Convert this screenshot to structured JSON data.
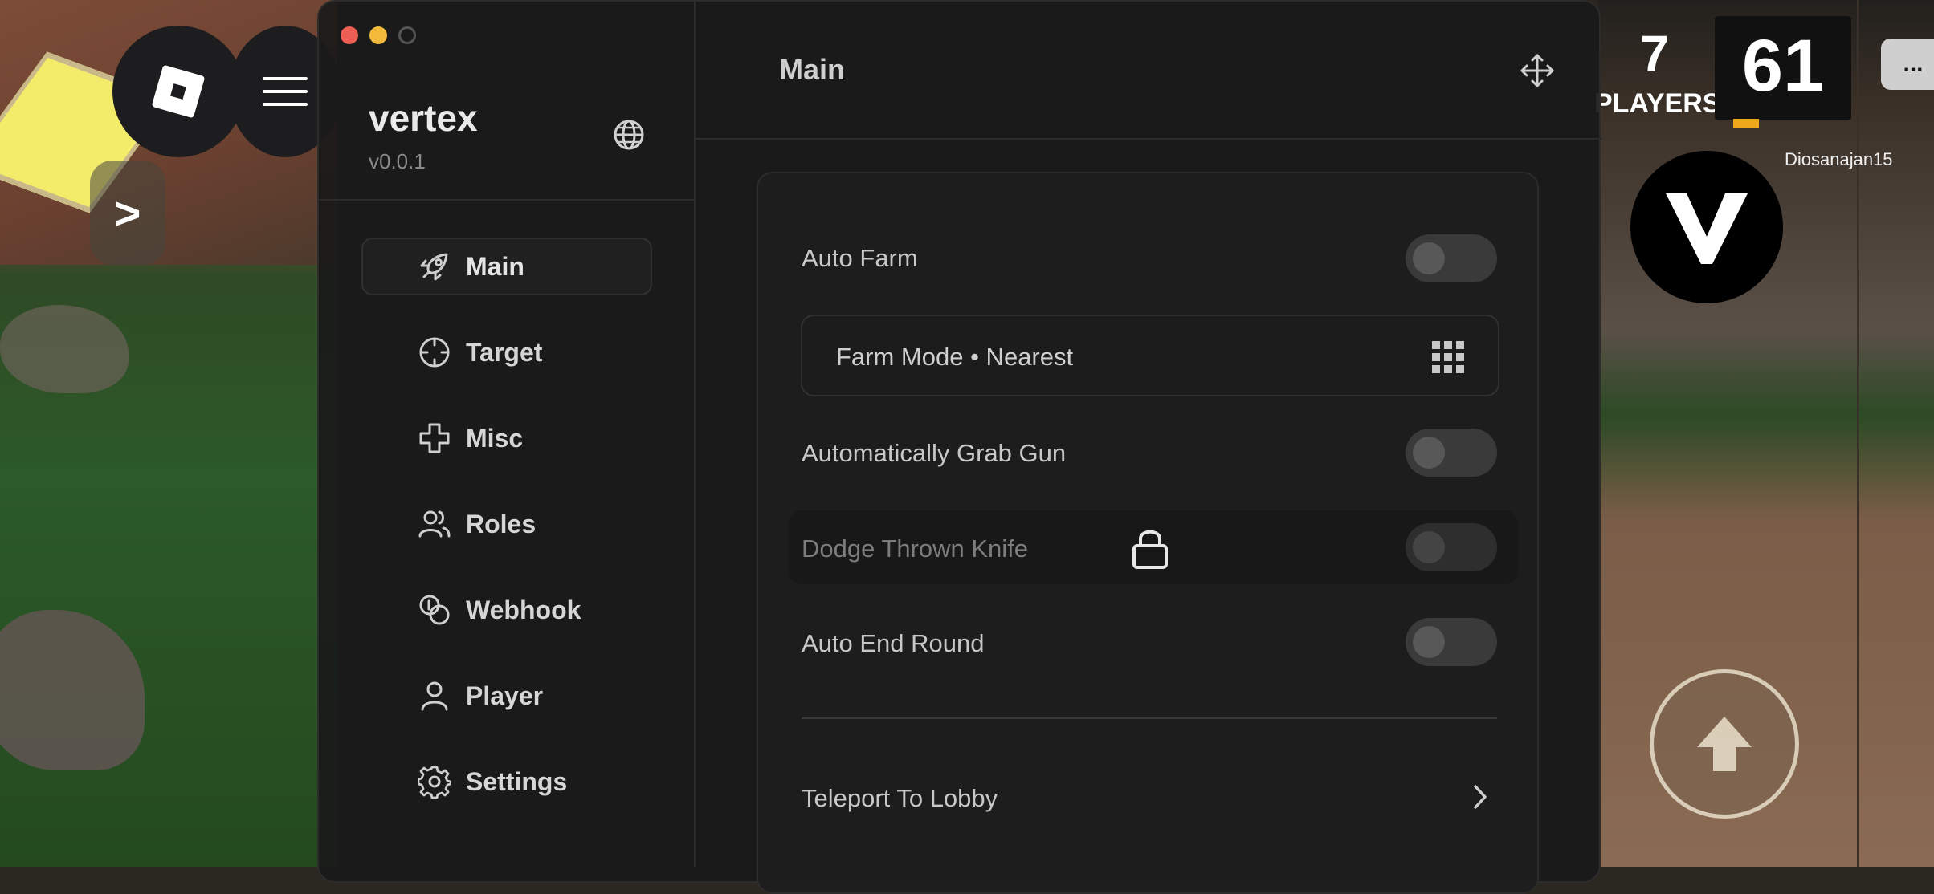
{
  "hud": {
    "players_count": "7",
    "players_label": "PLAYERS",
    "timer": "61",
    "chat_button": "...",
    "username": "Diosanajan15",
    "expand_label": ">"
  },
  "window": {
    "brand": {
      "name": "vertex",
      "version": "v0.0.1"
    },
    "nav": [
      {
        "label": "Main",
        "icon": "rocket-icon",
        "active": true
      },
      {
        "label": "Target",
        "icon": "crosshair-icon"
      },
      {
        "label": "Misc",
        "icon": "plus-icon"
      },
      {
        "label": "Roles",
        "icon": "users-icon"
      },
      {
        "label": "Webhook",
        "icon": "coins-icon"
      },
      {
        "label": "Player",
        "icon": "user-icon"
      },
      {
        "label": "Settings",
        "icon": "gear-icon"
      }
    ],
    "header": {
      "title": "Main"
    },
    "settings": {
      "auto_farm": {
        "label": "Auto Farm",
        "enabled": false
      },
      "farm_mode": {
        "label": "Farm Mode • Nearest"
      },
      "grab_gun": {
        "label": "Automatically Grab Gun",
        "enabled": false
      },
      "dodge_knife": {
        "label": "Dodge Thrown Knife",
        "enabled": false,
        "locked": true
      },
      "auto_end_round": {
        "label": "Auto End Round",
        "enabled": false
      },
      "teleport_lobby": {
        "label": "Teleport To Lobby"
      }
    }
  },
  "colors": {
    "traffic_red": "#ed5f55",
    "traffic_yellow": "#f3b93b",
    "timer_bar": "#f0a81a"
  }
}
